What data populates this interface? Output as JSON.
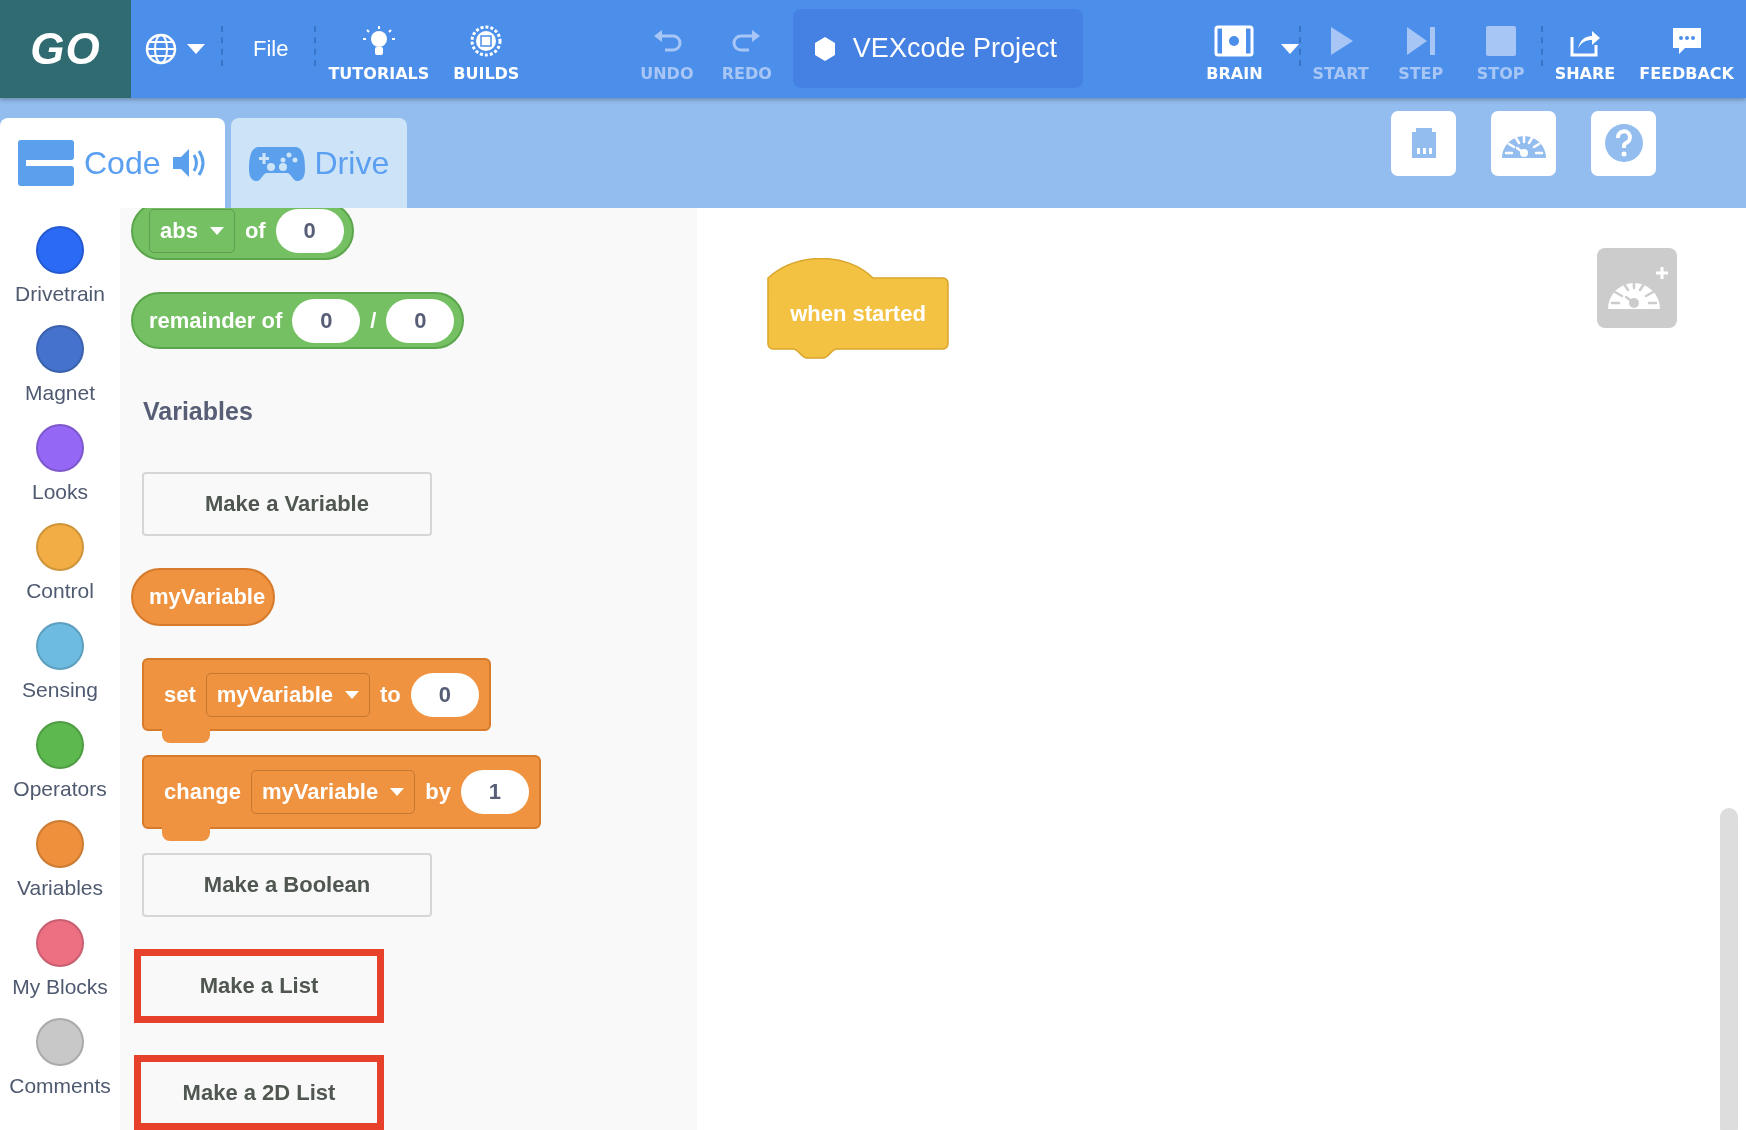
{
  "toolbar": {
    "logo": "GO",
    "menu": "File",
    "tools": [
      {
        "kind": "tutorials",
        "label": "TUTORIALS",
        "disabled": false
      },
      {
        "kind": "builds",
        "label": "BUILDS",
        "disabled": false
      },
      {
        "kind": "undo",
        "label": "UNDO",
        "disabled": true
      },
      {
        "kind": "redo",
        "label": "REDO",
        "disabled": true
      }
    ],
    "project_title": "VEXcode Project",
    "device": {
      "label": "BRAIN"
    },
    "run_controls": [
      {
        "kind": "start",
        "label": "START",
        "disabled": true
      },
      {
        "kind": "step",
        "label": "STEP",
        "disabled": true
      },
      {
        "kind": "stop",
        "label": "STOP",
        "disabled": true
      }
    ],
    "actions": [
      {
        "kind": "share",
        "label": "SHARE",
        "disabled": false
      },
      {
        "kind": "feedback",
        "label": "FEEDBACK",
        "disabled": false
      }
    ]
  },
  "tabs": [
    {
      "kind": "code",
      "label": "Code",
      "selected": true
    },
    {
      "kind": "drive",
      "label": "Drive",
      "selected": false
    }
  ],
  "panel_buttons": [
    {
      "kind": "ports"
    },
    {
      "kind": "dashboard"
    },
    {
      "kind": "help"
    }
  ],
  "categories": [
    {
      "name": "Drivetrain",
      "color": "#2a6af5"
    },
    {
      "name": "Magnet",
      "color": "#4472cc"
    },
    {
      "name": "Looks",
      "color": "#9467f4"
    },
    {
      "name": "Control",
      "color": "#f2ae45"
    },
    {
      "name": "Sensing",
      "color": "#6dbbe0"
    },
    {
      "name": "Operators",
      "color": "#5cb84f"
    },
    {
      "name": "Variables",
      "color": "#ef913c"
    },
    {
      "name": "My Blocks",
      "color": "#ec6f82"
    },
    {
      "name": "Comments",
      "color": "#c8c8c8"
    }
  ],
  "palette": [
    {
      "kind": "operator",
      "parts": [
        {
          "kind": "dropdown",
          "text": "abs"
        },
        {
          "kind": "label",
          "text": "of"
        },
        {
          "kind": "input",
          "text": "0"
        }
      ]
    },
    {
      "kind": "operator",
      "parts": [
        {
          "kind": "label",
          "text": "remainder of"
        },
        {
          "kind": "input",
          "text": "0"
        },
        {
          "kind": "label",
          "text": "/"
        },
        {
          "kind": "input",
          "text": "0"
        }
      ]
    },
    {
      "kind": "heading",
      "text": "Variables"
    },
    {
      "kind": "button",
      "text": "Make a Variable",
      "highlighted": false
    },
    {
      "kind": "variable",
      "parts": [
        {
          "kind": "label",
          "text": "myVariable"
        }
      ]
    },
    {
      "kind": "statement",
      "parts": [
        {
          "kind": "label",
          "text": "set"
        },
        {
          "kind": "dropdown",
          "text": "myVariable"
        },
        {
          "kind": "label",
          "text": "to"
        },
        {
          "kind": "input",
          "text": "0"
        }
      ]
    },
    {
      "kind": "statement",
      "parts": [
        {
          "kind": "label",
          "text": "change"
        },
        {
          "kind": "dropdown",
          "text": "myVariable"
        },
        {
          "kind": "label",
          "text": "by"
        },
        {
          "kind": "input",
          "text": "1"
        }
      ]
    },
    {
      "kind": "button",
      "text": "Make a Boolean",
      "highlighted": false
    },
    {
      "kind": "button",
      "text": "Make a List",
      "highlighted": true
    },
    {
      "kind": "button",
      "text": "Make a 2D List",
      "highlighted": true
    }
  ],
  "canvas": {
    "hat_block": {
      "label": "when started"
    }
  }
}
